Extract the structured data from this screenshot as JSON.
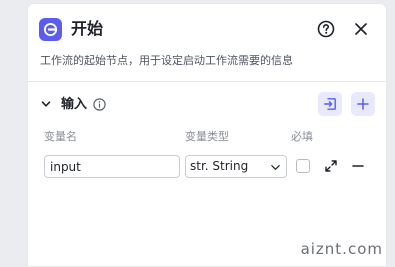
{
  "node": {
    "title": "开始",
    "description": "工作流的起始节点，用于设定启动工作流需要的信息",
    "icon": "start-node-icon",
    "accent_color": "#5b5cf0"
  },
  "header_actions": {
    "help_icon": "question-circle-icon",
    "close_icon": "close-icon"
  },
  "input_section": {
    "title": "输入",
    "info_icon": "info-circle-icon",
    "import_icon": "import-icon",
    "add_icon": "plus-icon",
    "columns": {
      "name": "变量名",
      "type": "变量类型",
      "required": "必填"
    },
    "rows": [
      {
        "name": "input",
        "type": "str. String",
        "required": false
      }
    ]
  },
  "watermark": "aiznt.com"
}
